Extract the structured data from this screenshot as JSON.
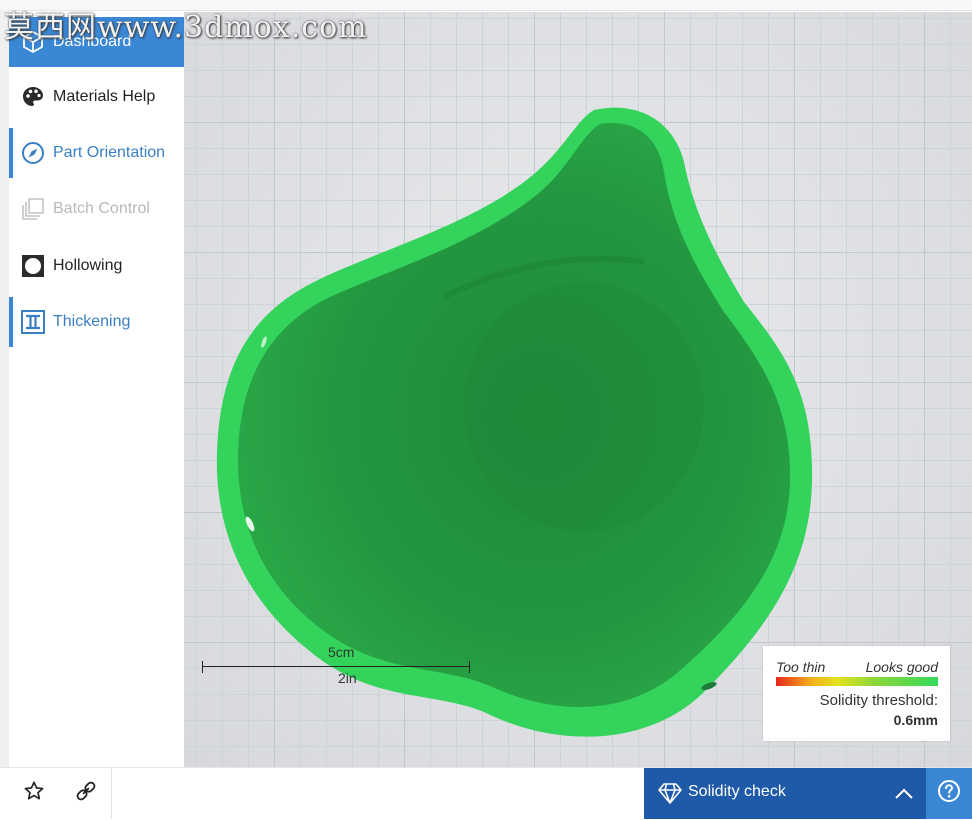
{
  "watermark": "莫西网www.3dmox.com",
  "sidebar": {
    "items": [
      {
        "label": "Dashboard",
        "icon": "cube-icon",
        "state": "active"
      },
      {
        "label": "Materials Help",
        "icon": "palette-icon",
        "state": "normal"
      },
      {
        "label": "Part Orientation",
        "icon": "compass-icon",
        "state": "accent"
      },
      {
        "label": "Batch Control",
        "icon": "layers-icon",
        "state": "disabled"
      },
      {
        "label": "Hollowing",
        "icon": "hollow-square-icon",
        "state": "normal"
      },
      {
        "label": "Thickening",
        "icon": "i-beam-icon",
        "state": "accent"
      }
    ]
  },
  "viewport": {
    "model_color": "#2fcf55",
    "scale": {
      "metric": "5cm",
      "imperial": "2in"
    }
  },
  "legend": {
    "too_thin": "Too thin",
    "looks_good": "Looks good",
    "threshold_label": "Solidity threshold:",
    "threshold_value": "0.6mm",
    "gradient_colors": [
      "#e8281c",
      "#f3b21d",
      "#e3e21e",
      "#8ed83a",
      "#34d85a"
    ]
  },
  "bottombar": {
    "favorite_icon": "star-icon",
    "share_icon": "link-icon",
    "solidity_label": "Solidity check",
    "solidity_icon": "diamond-icon",
    "expand_icon": "chevron-up-icon",
    "help_icon": "help-icon",
    "accent": "#1f5aa8"
  }
}
